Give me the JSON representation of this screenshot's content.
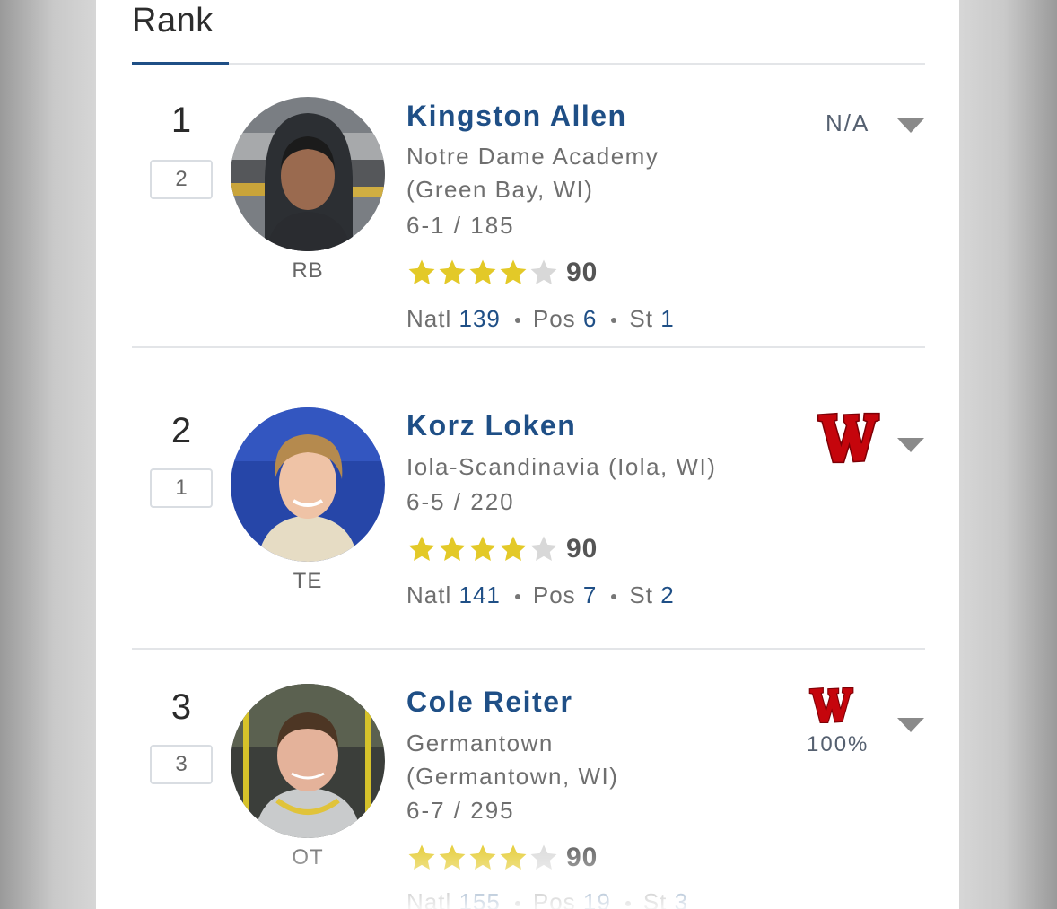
{
  "tab": {
    "title": "Rank"
  },
  "prospects": [
    {
      "rank": "1",
      "prev_rank": "2",
      "position": "RB",
      "name": "Kingston Allen",
      "school_line1": "Notre Dame Academy",
      "school_line2": "(Green Bay, WI)",
      "height_weight": "6-1 / 185",
      "stars_filled": 4,
      "stars_total": 5,
      "rating": "90",
      "natl_label": "Natl",
      "natl": "139",
      "pos_label": "Pos",
      "pos": "6",
      "st_label": "St",
      "st": "1",
      "commit_status": "N/A"
    },
    {
      "rank": "2",
      "prev_rank": "1",
      "position": "TE",
      "name": "Korz Loken",
      "school_line1": "Iola-Scandinavia (Iola, WI)",
      "school_line2": "",
      "height_weight": "6-5 / 220",
      "stars_filled": 4,
      "stars_total": 5,
      "rating": "90",
      "natl_label": "Natl",
      "natl": "141",
      "pos_label": "Pos",
      "pos": "7",
      "st_label": "St",
      "st": "2",
      "commit_logo": "wisconsin-w-logo"
    },
    {
      "rank": "3",
      "prev_rank": "3",
      "position": "OT",
      "name": "Cole Reiter",
      "school_line1": "Germantown",
      "school_line2": "(Germantown, WI)",
      "height_weight": "6-7 / 295",
      "stars_filled": 4,
      "stars_total": 5,
      "rating": "90",
      "natl_label": "Natl",
      "natl": "155",
      "pos_label": "Pos",
      "pos": "19",
      "st_label": "St",
      "st": "3",
      "commit_logo": "wisconsin-w-logo",
      "prediction_pct": "100%"
    }
  ],
  "colors": {
    "accent": "#1f4f86",
    "star_gold": "#e3c928",
    "star_empty": "#d8d8d8",
    "badger_red": "#c5050c"
  }
}
